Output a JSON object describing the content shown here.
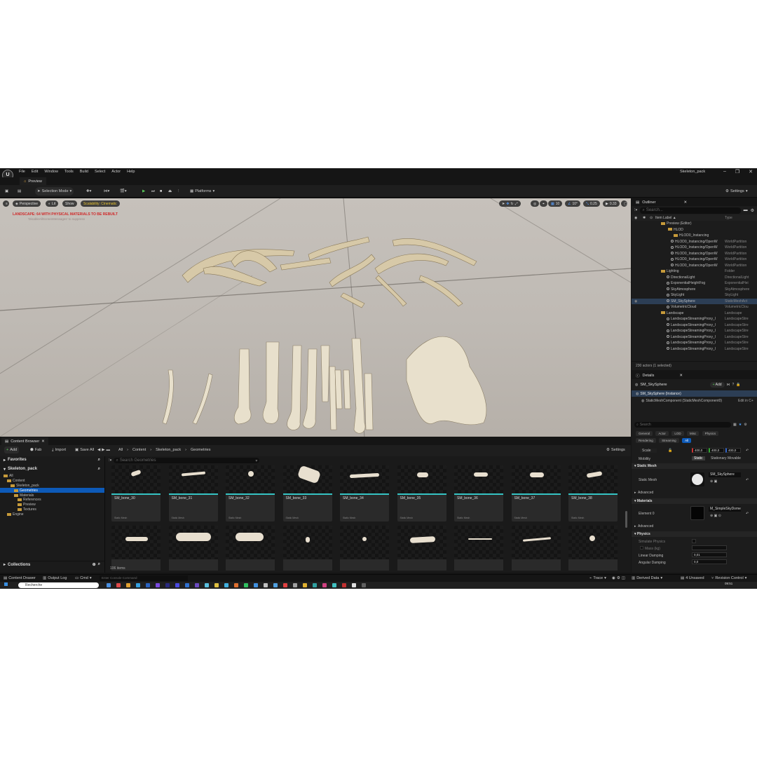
{
  "menubar": {
    "logo": "U",
    "menus": [
      "File",
      "Edit",
      "Window",
      "Tools",
      "Build",
      "Select",
      "Actor",
      "Help"
    ],
    "project_name": "Skeleton_pack"
  },
  "level_tab": {
    "label": "Preview"
  },
  "toolbar": {
    "selection_mode": "Selection Mode",
    "platforms": "Platforms",
    "settings": "Settings"
  },
  "viewport": {
    "perspective": "Perspective",
    "lit": "Lit",
    "show": "Show",
    "scalability": "Scalability: Cinematic",
    "warning": "LANDSCAPE: 64  WITH PHYSICAL MATERIALS  TO BE REBUILT",
    "warning_sub": "'DisableAllScreenMessages' to suppress",
    "grid_snap": "10",
    "rot_snap": "10°",
    "scale_snap": "0.25",
    "cam_speed": "0.33"
  },
  "outliner": {
    "title": "Outliner",
    "search_placeholder": "Search...",
    "col_label": "Item Label ▲",
    "col_type": "Type",
    "rows": [
      {
        "name": "Preview (Editor)",
        "type": ""
      },
      {
        "name": "HLOD",
        "type": ""
      },
      {
        "name": "HLOD0_Instancing",
        "type": ""
      },
      {
        "name": "HLOD0_Instancing/OpenW",
        "type": "WorldPartition"
      },
      {
        "name": "HLOD0_Instancing/OpenW",
        "type": "WorldPartition"
      },
      {
        "name": "HLOD0_Instancing/OpenW",
        "type": "WorldPartition"
      },
      {
        "name": "HLOD0_Instancing/OpenW",
        "type": "WorldPartition"
      },
      {
        "name": "HLOD0_Instancing/OpenW",
        "type": "WorldPartition"
      },
      {
        "name": "Lighting",
        "type": "Folder"
      },
      {
        "name": "DirectionalLight",
        "type": "DirectionalLight"
      },
      {
        "name": "ExponentialHeightFog",
        "type": "ExponentialHei"
      },
      {
        "name": "SkyAtmosphere",
        "type": "SkyAtmosphere"
      },
      {
        "name": "SkyLight",
        "type": "SkyLight"
      },
      {
        "name": "SM_SkySphere",
        "type": "StaticMeshAct"
      },
      {
        "name": "VolumetricCloud",
        "type": "VolumetricClou"
      },
      {
        "name": "Landscape",
        "type": "Landscape"
      },
      {
        "name": "LandscapeStreamingProxy_l",
        "type": "LandscapeStre"
      },
      {
        "name": "LandscapeStreamingProxy_l",
        "type": "LandscapeStre"
      },
      {
        "name": "LandscapeStreamingProxy_l",
        "type": "LandscapeStre"
      },
      {
        "name": "LandscapeStreamingProxy_l",
        "type": "LandscapeStre"
      },
      {
        "name": "LandscapeStreamingProxy_l",
        "type": "LandscapeStre"
      },
      {
        "name": "LandscapeStreamingProxy_l",
        "type": "LandscapeStre"
      }
    ],
    "footer": "230 actors (1 selected)"
  },
  "details": {
    "title": "Details",
    "object_name": "SM_SkySphere",
    "add": "Add",
    "instance": "SM_SkySphere (Instance)",
    "component": "StaticMeshComponent (StaticMeshComponent0)",
    "edit_in": "Edit in C+",
    "search_placeholder": "Search",
    "filter_tabs_1": [
      "General",
      "Actor",
      "LOD",
      "Misc",
      "Physics"
    ],
    "filter_tabs_2": [
      "Rendering",
      "Streaming",
      "All"
    ],
    "scale_label": "Scale",
    "scale_values": [
      "400,0",
      "400,0",
      "400,0"
    ],
    "mobility_label": "Mobility",
    "mobility_options": [
      "Static",
      "Stationary",
      "Movable"
    ],
    "section_static_mesh": "Static Mesh",
    "static_mesh_label": "Static Mesh",
    "static_mesh_value": "SM_SkySphere",
    "advanced_1": "Advanced",
    "section_materials": "Materials",
    "element0_label": "Element 0",
    "element0_value": "M_SimpleSkyDome",
    "advanced_2": "Advanced",
    "section_physics": "Physics",
    "simulate_physics": "Simulate Physics",
    "mass_kg": "Mass (kg)",
    "linear_damping_label": "Linear Damping",
    "linear_damping_value": "0,01",
    "angular_damping_label": "Angular Damping",
    "angular_damping_value": "0,0"
  },
  "content_browser": {
    "tab": "Content Browser",
    "add": "Add",
    "fab": "Fab",
    "import": "Import",
    "save_all": "Save All",
    "breadcrumb": [
      "All",
      "Content",
      "Skeleton_pack",
      "Geometries"
    ],
    "settings": "Settings",
    "favorites": "Favorites",
    "root": "Skeleton_pack",
    "search_placeholder": "Search Geometries",
    "tree": [
      {
        "label": "All",
        "depth": 0
      },
      {
        "label": "Content",
        "depth": 1
      },
      {
        "label": "Skeleton_pack",
        "depth": 2
      },
      {
        "label": "Geometries",
        "depth": 3
      },
      {
        "label": "Materials",
        "depth": 3
      },
      {
        "label": "References",
        "depth": 4
      },
      {
        "label": "Preview",
        "depth": 4
      },
      {
        "label": "Textures",
        "depth": 4
      },
      {
        "label": "Engine",
        "depth": 1
      }
    ],
    "collections": "Collections",
    "items_count": "106 items",
    "asset_type": "Static Mesh",
    "tiles": [
      "SM_bone_30",
      "SM_bone_31",
      "SM_bone_32",
      "SM_bone_33",
      "SM_bone_34",
      "SM_bone_35",
      "SM_bone_36",
      "SM_bone_37",
      "SM_bone_38"
    ]
  },
  "statusbar": {
    "content_drawer": "Content Drawer",
    "output_log": "Output Log",
    "cmd": "Cmd",
    "console_placeholder": "Enter Console Command",
    "trace": "Trace",
    "derived_data": "Derived Data",
    "unsaved": "4 Unsaved",
    "revision_control": "Revision Control"
  },
  "taskbar": {
    "search": "Recherche",
    "time": "09:51"
  }
}
